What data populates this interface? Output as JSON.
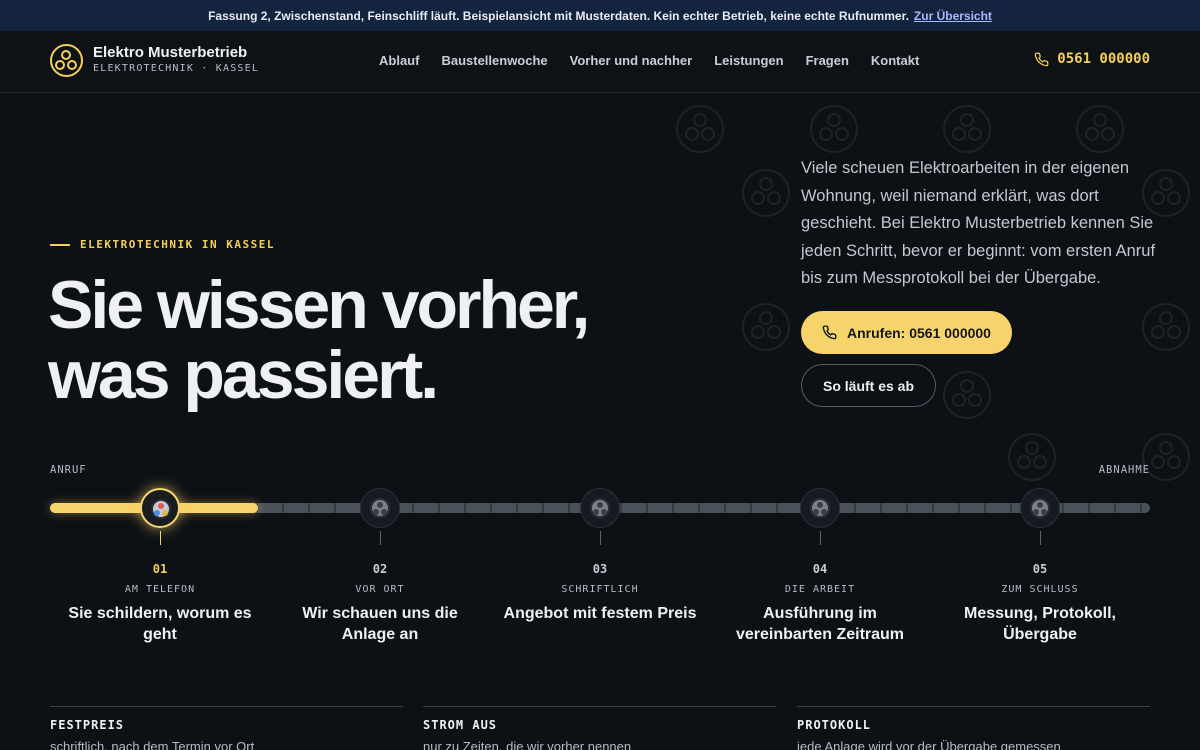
{
  "notice": {
    "text": "Fassung 2, Zwischenstand, Feinschliff läuft. Beispielansicht mit Musterdaten. Kein echter Betrieb, keine echte Rufnummer.",
    "link": "Zur Übersicht"
  },
  "header": {
    "logo_icon": "three-circles-logo-icon",
    "brand": "Elektro Musterbetrieb",
    "subtitle": "ELEKTROTECHNIK · KASSEL",
    "nav": [
      "Ablauf",
      "Baustellenwoche",
      "Vorher und nachher",
      "Leistungen",
      "Fragen",
      "Kontakt"
    ],
    "phone_icon": "phone-icon",
    "phone": "0561 000000"
  },
  "hero": {
    "eyebrow": "ELEKTROTECHNIK IN KASSEL",
    "headline_line1": "Sie wissen vorher,",
    "headline_line2": "was passiert.",
    "lead": "Viele scheuen Elektroarbeiten in der eigenen Wohnung, weil niemand erklärt, was dort geschieht. Bei Elektro Musterbetrieb kennen Sie jeden Schritt, bevor er beginnt: vom ersten Anruf bis zum Messprotokoll bei der Übergabe.",
    "call_button": "Anrufen: 0561 000000",
    "flow_button": "So läuft es ab",
    "accent_color": "#f7d46b"
  },
  "timeline": {
    "start_label": "ANRUF",
    "end_label": "ABNAHME",
    "active_step": 1,
    "steps": [
      {
        "num": "01",
        "kicker": "AM TELEFON",
        "title": "Sie schildern, worum es geht"
      },
      {
        "num": "02",
        "kicker": "VOR ORT",
        "title": "Wir schauen uns die Anlage an"
      },
      {
        "num": "03",
        "kicker": "SCHRIFTLICH",
        "title": "Angebot mit festem Preis"
      },
      {
        "num": "04",
        "kicker": "DIE ARBEIT",
        "title": "Ausführung im vereinbarten Zeitraum"
      },
      {
        "num": "05",
        "kicker": "ZUM SCHLUSS",
        "title": "Messung, Protokoll, Übergabe"
      }
    ]
  },
  "features": [
    {
      "title": "FESTPREIS",
      "text": "schriftlich, nach dem Termin vor Ort"
    },
    {
      "title": "STROM AUS",
      "text": "nur zu Zeiten, die wir vorher nennen"
    },
    {
      "title": "PROTOKOLL",
      "text": "jede Anlage wird vor der Übergabe gemessen"
    }
  ]
}
